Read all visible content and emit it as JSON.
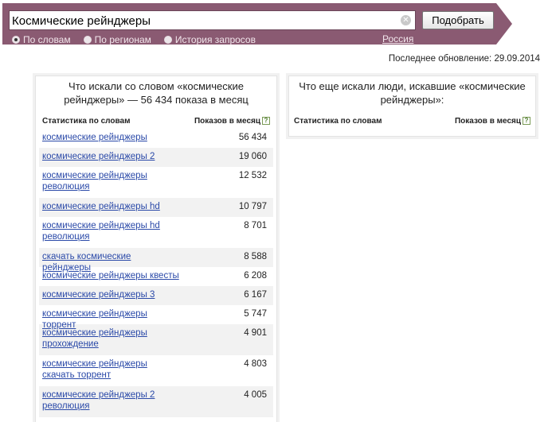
{
  "search": {
    "query": "Космические рейнджеры",
    "button_label": "Подобрать",
    "clear_icon": "close-icon"
  },
  "modes": [
    {
      "label": "По словам",
      "checked": true
    },
    {
      "label": "По регионам",
      "checked": false
    },
    {
      "label": "История запросов",
      "checked": false
    }
  ],
  "region_link": "Россия",
  "last_update": "Последнее обновление: 29.09.2014",
  "left_panel": {
    "title": "Что искали со словом «космические рейнджеры» — 56 434 показа в месяц",
    "col_words": "Статистика по словам",
    "col_shows": "Показов в месяц",
    "rows": [
      {
        "phrase": "космические рейнджеры",
        "count": "56 434"
      },
      {
        "phrase": "космические рейнджеры 2",
        "count": "19 060"
      },
      {
        "phrase": "космические рейнджеры революция",
        "count": "12 532"
      },
      {
        "phrase": "космические рейнджеры hd",
        "count": "10 797"
      },
      {
        "phrase": "космические рейнджеры hd революция",
        "count": "8 701"
      },
      {
        "phrase": "скачать космические рейнджеры",
        "count": "8 588"
      },
      {
        "phrase": "космические рейнджеры квесты",
        "count": "6 208"
      },
      {
        "phrase": "космические рейнджеры 3",
        "count": "6 167"
      },
      {
        "phrase": "космические рейнджеры торрент",
        "count": "5 747"
      },
      {
        "phrase": "космические рейнджеры прохождение",
        "count": "4 901"
      },
      {
        "phrase": "космические рейнджеры скачать торрент",
        "count": "4 803"
      },
      {
        "phrase": "космические рейнджеры 2 революция",
        "count": "4 005"
      }
    ]
  },
  "right_panel": {
    "title": "Что еще искали люди, искавшие «космические рейнджеры»:",
    "col_words": "Статистика по словам",
    "col_shows": "Показов в месяц"
  },
  "colors": {
    "header": "#8a5a72",
    "link": "#2a49a8",
    "row_alt": "#f2f2f2"
  }
}
